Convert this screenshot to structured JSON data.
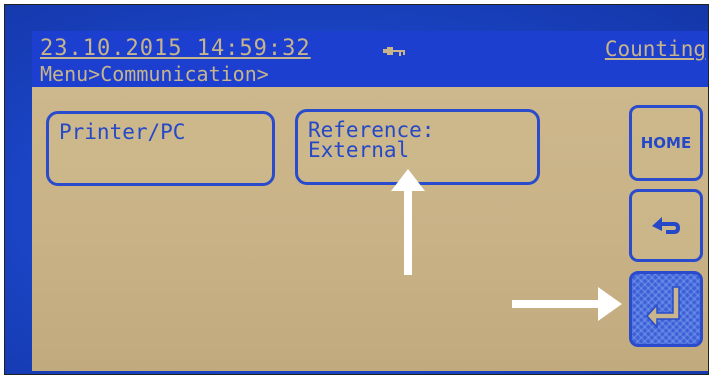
{
  "status": {
    "datetime": "23.10.2015 14:59:32",
    "connection_icon": "key-plug-icon",
    "mode": "Counting"
  },
  "breadcrumb": "Menu>Communication>",
  "tiles": {
    "printer": {
      "label": "Printer/PC"
    },
    "reference": {
      "line1": "Reference:",
      "line2": "External"
    }
  },
  "side_buttons": {
    "home_label": "HOME",
    "back_icon": "return-arrow-icon",
    "enter_icon": "enter-arrow-icon"
  },
  "colors": {
    "screen_bg": "#c8b286",
    "blue": "#1d3fcf",
    "text_on_bar": "#c7b48a",
    "annotation": "#ffffff"
  }
}
